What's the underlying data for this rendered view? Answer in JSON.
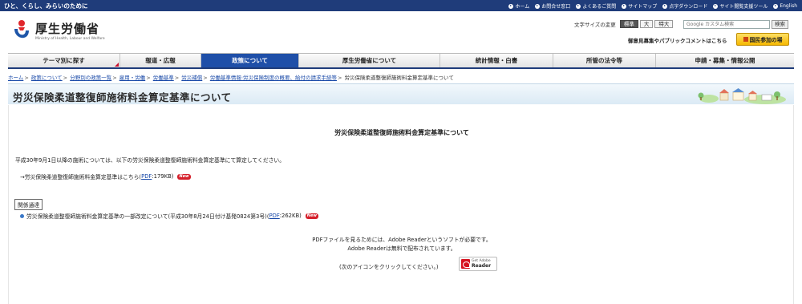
{
  "topbar": {
    "tagline": "ひと、くらし、みらいのために",
    "links": [
      {
        "name": "home",
        "label": "ホーム"
      },
      {
        "name": "contact",
        "label": "お問合せ窓口"
      },
      {
        "name": "faq",
        "label": "よくあるご質問"
      },
      {
        "name": "sitemap",
        "label": "サイトマップ"
      },
      {
        "name": "braille",
        "label": "点字ダウンロード"
      },
      {
        "name": "accessibility",
        "label": "サイト閲覧支援ツール"
      },
      {
        "name": "english",
        "label": "English"
      }
    ]
  },
  "header": {
    "logo_ja": "厚生労働省",
    "logo_en": "Ministry of Health, Labour and Welfare",
    "fontsize_label": "文字サイズの変更",
    "fontsize_options": [
      "標準",
      "大",
      "特大"
    ],
    "search_placeholder": "Google カスタム検索",
    "search_button": "検索",
    "pubcomment_link": "御意見募集やパブリックコメントはこちら",
    "participate_button": "国民参加の場"
  },
  "nav": [
    {
      "label": "テーマ別に探す",
      "active": false
    },
    {
      "label": "報道・広報",
      "active": false
    },
    {
      "label": "政策について",
      "active": true
    },
    {
      "label": "厚生労働省について",
      "active": false
    },
    {
      "label": "統計情報・白書",
      "active": false
    },
    {
      "label": "所管の法令等",
      "active": false
    },
    {
      "label": "申請・募集・情報公開",
      "active": false
    }
  ],
  "breadcrumb": {
    "items": [
      "ホーム",
      "政策について",
      "分野別の政策一覧",
      "雇用・労働",
      "労働基準",
      "労災補償",
      "労働基準情報:労災保険制度の概要、給付の請求手続等"
    ],
    "current": "労災保険柔道整復師施術料金算定基準について",
    "separator": ">"
  },
  "page": {
    "title": "労災保険柔道整復師施術料金算定基準について"
  },
  "content": {
    "heading": "労災保険柔道整復師施術料金算定基準について",
    "intro": "平成30年9月1日以降の施術については、以下の労災保険柔道整復師施術料金算定基準にて算定してください。",
    "link1_prefix": "→労災保険柔道整復師施術料金算定基準はこちら(",
    "link1_pdf": "PDF",
    "link1_suffix": ":179KB)",
    "new_badge": "New",
    "related_label": "関係通達",
    "related_prefix": "労災保険柔道整復師施術料金算定基準の一部改定について(平成30年8月24日付け基発0824第3号)(",
    "related_pdf": "PDF",
    "related_suffix": ":262KB)",
    "pdf_note1": "PDFファイルを見るためには、Adobe Readerというソフトが必要です。",
    "pdf_note2": "Adobe Readerは無料で配布されています。",
    "pdf_note3": "(次のアイコンをクリックしてください。)",
    "adobe_t1": "Get Adobe",
    "adobe_t2": "Reader"
  }
}
